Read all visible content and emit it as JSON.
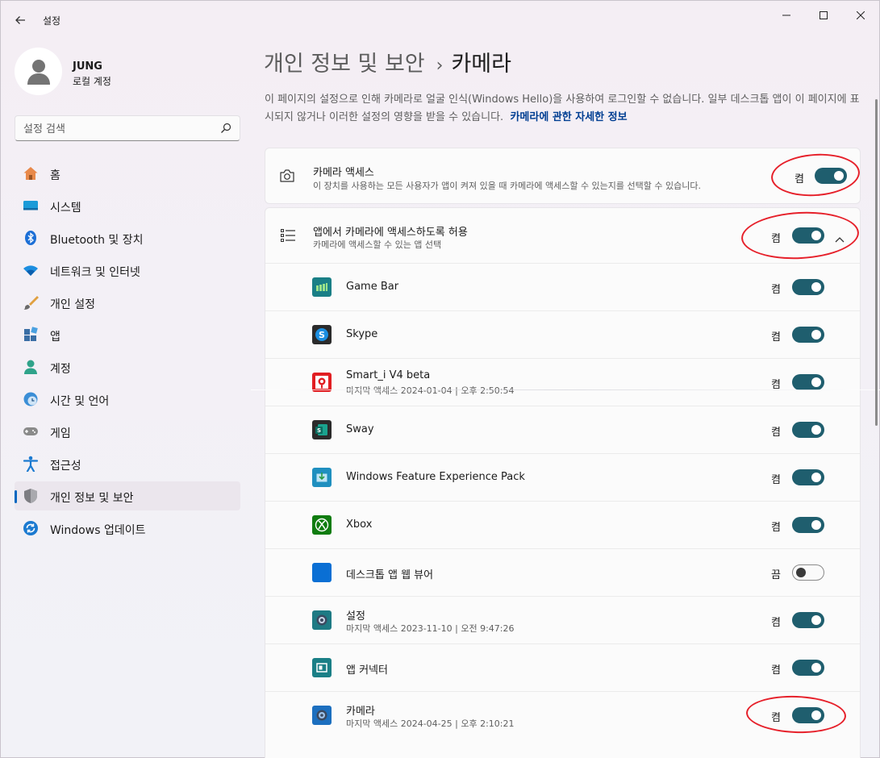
{
  "window": {
    "title": "설정"
  },
  "profile": {
    "name": "JUNG",
    "account_type": "로컬 계정"
  },
  "search": {
    "placeholder": "설정 검색"
  },
  "sidebar": {
    "items": [
      {
        "label": "홈",
        "icon": "home-icon"
      },
      {
        "label": "시스템",
        "icon": "system-icon"
      },
      {
        "label": "Bluetooth 및 장치",
        "icon": "bluetooth-icon"
      },
      {
        "label": "네트워크 및 인터넷",
        "icon": "wifi-icon"
      },
      {
        "label": "개인 설정",
        "icon": "brush-icon"
      },
      {
        "label": "앱",
        "icon": "apps-icon"
      },
      {
        "label": "계정",
        "icon": "account-icon"
      },
      {
        "label": "시간 및 언어",
        "icon": "time-language-icon"
      },
      {
        "label": "게임",
        "icon": "gamepad-icon"
      },
      {
        "label": "접근성",
        "icon": "accessibility-icon"
      },
      {
        "label": "개인 정보 및 보안",
        "icon": "shield-icon",
        "active": true
      },
      {
        "label": "Windows 업데이트",
        "icon": "update-icon"
      }
    ]
  },
  "breadcrumb": {
    "parent": "개인 정보 및 보안",
    "separator": "›",
    "current": "카메라"
  },
  "info": {
    "text": "이 페이지의 설정으로 인해 카메라로 얼굴 인식(Windows Hello)을 사용하여 로그인할 수 없습니다. 일부 데스크톱 앱이 이 페이지에 표시되지 않거나 이러한 설정의 영향을 받을 수 있습니다.",
    "link": "카메라에 관한 자세한 정보"
  },
  "camera_access": {
    "title": "카메라 액세스",
    "description": "이 장치를 사용하는 모든 사용자가 앱이 켜져 있을 때 카메라에 액세스할 수 있는지를 선택할 수 있습니다.",
    "state": "켬",
    "on": true
  },
  "app_access": {
    "title": "앱에서 카메라에 액세스하도록 허용",
    "description": "카메라에 액세스할 수 있는 앱 선택",
    "state": "켬",
    "on": true
  },
  "apps": [
    {
      "name": "Game Bar",
      "sub": "",
      "state": "켬",
      "on": true,
      "icon": "game-bar-icon",
      "color": "#1a7f86"
    },
    {
      "name": "Skype",
      "sub": "",
      "state": "켬",
      "on": true,
      "icon": "skype-icon",
      "color": "#2b2b2b"
    },
    {
      "name": "Smart_i V4 beta",
      "sub": "마지막 액세스 2024-01-04 | 오후 2:50:54",
      "state": "켬",
      "on": true,
      "icon": "smart-i-icon",
      "color": "#e11e22"
    },
    {
      "name": "Sway",
      "sub": "",
      "state": "켬",
      "on": true,
      "icon": "sway-icon",
      "color": "#2b2b2b"
    },
    {
      "name": "Windows Feature Experience Pack",
      "sub": "",
      "state": "켬",
      "on": true,
      "icon": "feature-pack-icon",
      "color": "#1f8fbf"
    },
    {
      "name": "Xbox",
      "sub": "",
      "state": "켬",
      "on": true,
      "icon": "xbox-icon",
      "color": "#107c10"
    },
    {
      "name": "데스크톱 앱 웹 뷰어",
      "sub": "",
      "state": "끔",
      "on": false,
      "icon": "web-viewer-icon",
      "color": "#0a6fd4"
    },
    {
      "name": "설정",
      "sub": "마지막 액세스 2023-11-10 | 오전 9:47:26",
      "state": "켬",
      "on": true,
      "icon": "settings-app-icon",
      "color": "#1e7a84"
    },
    {
      "name": "앱 커넥터",
      "sub": "",
      "state": "켬",
      "on": true,
      "icon": "app-connector-icon",
      "color": "#1a7f86"
    },
    {
      "name": "카메라",
      "sub": "마지막 액세스 2024-04-25 | 오후 2:10:21",
      "state": "켬",
      "on": true,
      "icon": "camera-app-icon",
      "color": "#1c6fbf"
    }
  ],
  "colors": {
    "toggle_on": "#1f5e6e",
    "accent": "#0067c0",
    "annotation": "#e6202a"
  }
}
